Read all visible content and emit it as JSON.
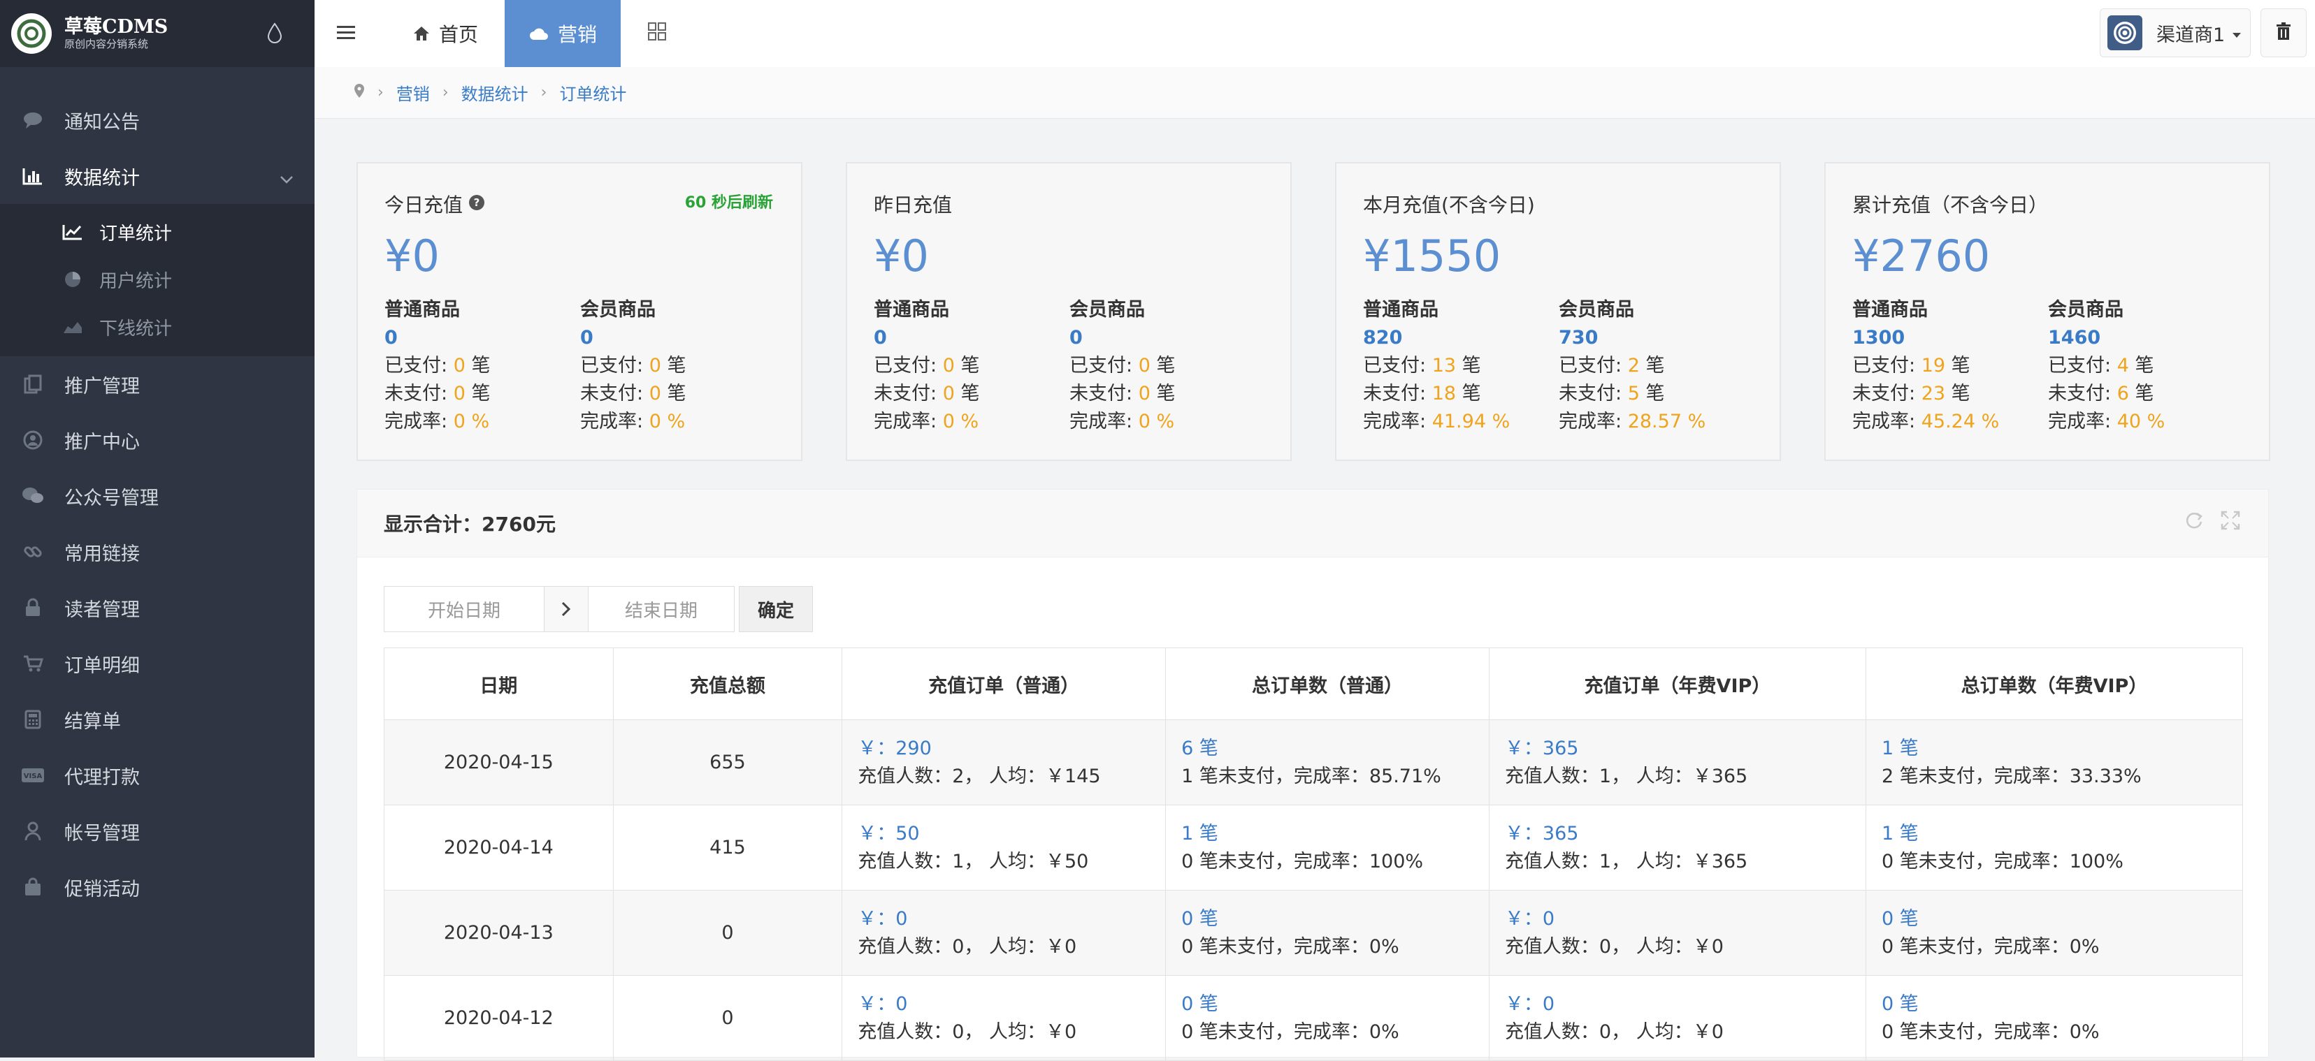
{
  "brand": {
    "title": "草莓CDMS",
    "subtitle": "原创内容分销系统"
  },
  "sidebar": {
    "items": [
      {
        "label": "通知公告",
        "icon": "comment-icon"
      },
      {
        "label": "数据统计",
        "icon": "bar-chart-icon",
        "open": true,
        "children": [
          {
            "label": "订单统计",
            "icon": "line-chart-icon",
            "active": true
          },
          {
            "label": "用户统计",
            "icon": "pie-chart-icon"
          },
          {
            "label": "下线统计",
            "icon": "area-chart-icon"
          }
        ]
      },
      {
        "label": "推广管理",
        "icon": "copy-icon"
      },
      {
        "label": "推广中心",
        "icon": "user-circle-icon"
      },
      {
        "label": "公众号管理",
        "icon": "wechat-icon"
      },
      {
        "label": "常用链接",
        "icon": "link-icon"
      },
      {
        "label": "读者管理",
        "icon": "lock-icon"
      },
      {
        "label": "订单明细",
        "icon": "cart-icon"
      },
      {
        "label": "结算单",
        "icon": "calculator-icon"
      },
      {
        "label": "代理打款",
        "icon": "visa-card-icon"
      },
      {
        "label": "帐号管理",
        "icon": "user-icon"
      },
      {
        "label": "促销活动",
        "icon": "shopping-bag-icon"
      }
    ]
  },
  "topbar": {
    "tabs": [
      {
        "label": "首页",
        "icon": "home-icon"
      },
      {
        "label": "营销",
        "icon": "cloud-icon",
        "active": true
      }
    ],
    "user": "渠道商1"
  },
  "breadcrumb": [
    "营销",
    "数据统计",
    "订单统计"
  ],
  "cards": [
    {
      "title": "今日充值",
      "refresh": "60 秒后刷新",
      "amount": "¥0",
      "cols": [
        {
          "head": "普通商品",
          "value": "0",
          "paid": "0",
          "unpaid": "0",
          "rate": "0 %"
        },
        {
          "head": "会员商品",
          "value": "0",
          "paid": "0",
          "unpaid": "0",
          "rate": "0 %"
        }
      ]
    },
    {
      "title": "昨日充值",
      "amount": "¥0",
      "cols": [
        {
          "head": "普通商品",
          "value": "0",
          "paid": "0",
          "unpaid": "0",
          "rate": "0 %"
        },
        {
          "head": "会员商品",
          "value": "0",
          "paid": "0",
          "unpaid": "0",
          "rate": "0 %"
        }
      ]
    },
    {
      "title": "本月充值(不含今日)",
      "amount": "¥1550",
      "cols": [
        {
          "head": "普通商品",
          "value": "820",
          "paid": "13",
          "unpaid": "18",
          "rate": "41.94 %"
        },
        {
          "head": "会员商品",
          "value": "730",
          "paid": "2",
          "unpaid": "5",
          "rate": "28.57 %"
        }
      ]
    },
    {
      "title": "累计充值（不含今日）",
      "amount": "¥2760",
      "cols": [
        {
          "head": "普通商品",
          "value": "1300",
          "paid": "19",
          "unpaid": "23",
          "rate": "45.24 %"
        },
        {
          "head": "会员商品",
          "value": "1460",
          "paid": "4",
          "unpaid": "6",
          "rate": "40 %"
        }
      ]
    }
  ],
  "labels": {
    "paid": "已支付:",
    "unpaid": "未支付:",
    "rate": "完成率:",
    "unit": "笔"
  },
  "panel": {
    "total_label": "显示合计：",
    "total_value": "2760元"
  },
  "filter": {
    "start_placeholder": "开始日期",
    "end_placeholder": "结束日期",
    "confirm": "确定"
  },
  "table": {
    "headers": [
      "日期",
      "充值总额",
      "充值订单（普通）",
      "总订单数（普通）",
      "充值订单（年费VIP）",
      "总订单数（年费VIP）"
    ],
    "rows": [
      {
        "date": "2020-04-15",
        "total": "655",
        "n_amt": "￥：290",
        "n_info": "充值人数：2，  人均：￥145",
        "n_cnt": "6 笔",
        "n_cinfo": "1  笔未支付，完成率：85.71%",
        "v_amt": "￥：365",
        "v_info": "充值人数：1，  人均：￥365",
        "v_cnt": "1 笔",
        "v_cinfo": "2  笔未支付，完成率：33.33%"
      },
      {
        "date": "2020-04-14",
        "total": "415",
        "n_amt": "￥：50",
        "n_info": "充值人数：1，  人均：￥50",
        "n_cnt": "1 笔",
        "n_cinfo": "0  笔未支付，完成率：100%",
        "v_amt": "￥：365",
        "v_info": "充值人数：1，  人均：￥365",
        "v_cnt": "1 笔",
        "v_cinfo": "0  笔未支付，完成率：100%"
      },
      {
        "date": "2020-04-13",
        "total": "0",
        "n_amt": "￥：0",
        "n_info": "充值人数：0，  人均：￥0",
        "n_cnt": "0 笔",
        "n_cinfo": "0  笔未支付，完成率：0%",
        "v_amt": "￥：0",
        "v_info": "充值人数：0，  人均：￥0",
        "v_cnt": "0 笔",
        "v_cinfo": "0  笔未支付，完成率：0%"
      },
      {
        "date": "2020-04-12",
        "total": "0",
        "n_amt": "￥：0",
        "n_info": "充值人数：0，  人均：￥0",
        "n_cnt": "0 笔",
        "n_cinfo": "0  笔未支付，完成率：0%",
        "v_amt": "￥：0",
        "v_info": "充值人数：0，  人均：￥0",
        "v_cnt": "0 笔",
        "v_cinfo": "0  笔未支付，完成率：0%"
      }
    ]
  },
  "colors": {
    "sidebar_bg": "#2f3542",
    "accent": "#5b8fd1",
    "link": "#3a7bc8",
    "highlight": "#f0a31c",
    "refresh": "#2aa336"
  }
}
